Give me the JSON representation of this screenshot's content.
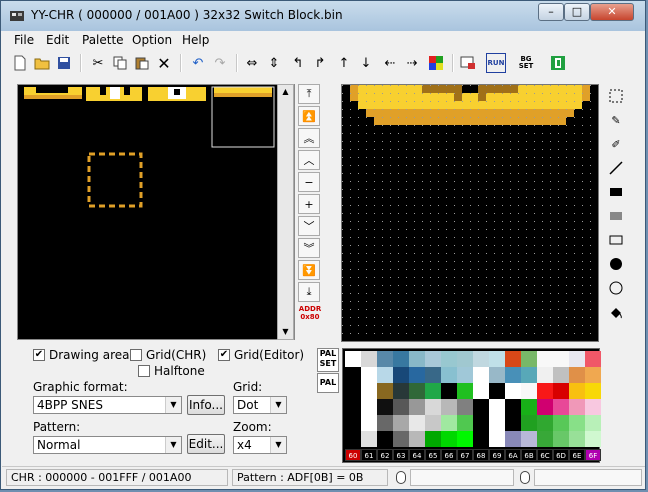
{
  "window": {
    "title": "YY-CHR ( 000000 / 001A00 ) 32x32 Switch Block.bin",
    "app_icon": "chr-icon"
  },
  "menu": [
    "File",
    "Edit",
    "Palette",
    "Option",
    "Help"
  ],
  "toolbar": {
    "buttons": [
      "new-icon",
      "open-icon",
      "save-icon",
      "cut-icon",
      "copy-icon",
      "paste-icon",
      "delete-icon",
      "undo-icon",
      "redo-icon",
      "flip-horizontal-icon",
      "flip-vertical-icon",
      "rotate-left-icon",
      "rotate-right-icon",
      "shift-up-icon",
      "shift-down-icon",
      "shift-left-icon",
      "shift-right-icon",
      "color-replace-icon",
      "pattern-icon",
      "run-icon",
      "bg-set-icon",
      "exit-icon"
    ],
    "run_label": "RUN",
    "bgset_label": "BG SET"
  },
  "nav": {
    "addr_label": "ADDR",
    "addr_value": "0x80"
  },
  "options": {
    "drawing_area": {
      "label": "Drawing area",
      "checked": true
    },
    "grid_chr": {
      "label": "Grid(CHR)",
      "checked": false
    },
    "grid_editor": {
      "label": "Grid(Editor)",
      "checked": true
    },
    "halftone": {
      "label": "Halftone",
      "checked": false
    }
  },
  "graphic_format": {
    "label": "Graphic format:",
    "value": "4BPP SNES",
    "info_button": "Info..."
  },
  "grid": {
    "label": "Grid:",
    "value": "Dot"
  },
  "pattern": {
    "label": "Pattern:",
    "value": "Normal",
    "edit_button": "Edit..."
  },
  "zoom": {
    "label": "Zoom:",
    "value": "x4"
  },
  "palette_panel": {
    "pal_set_label": "PAL SET",
    "pal_tab_label": "PAL",
    "indices": [
      "60",
      "61",
      "62",
      "63",
      "64",
      "65",
      "66",
      "67",
      "68",
      "69",
      "6A",
      "6B",
      "6C",
      "6D",
      "6E",
      "6F"
    ],
    "colors": [
      [
        "#ffffff",
        "#d8d8d8",
        "#5888a8",
        "#3878a0",
        "#88b8c8",
        "#a8c8d8",
        "#98c8d0",
        "#a0c8d0",
        "#c0d8e0",
        "#c0e0e8",
        "#d84818",
        "#78b868",
        "#f8f8f8",
        "#f8f8f8",
        "#e8e8f0",
        "#f05868"
      ],
      [
        "#000000",
        "#ffffff",
        "#b8d8e8",
        "#184878",
        "#2868a0",
        "#386888",
        "#88c0d0",
        "#a0c8d8",
        "#ffffff",
        "#98b8c8",
        "#4890b8",
        "#58a8b8",
        "#f0f0f0",
        "#c0c0c0",
        "#e09048",
        "#f0a850"
      ],
      [
        "#000000",
        "#ffffff",
        "#886820",
        "#283838",
        "#306838",
        "#20a848",
        "#000000",
        "#20c020",
        "#ffffff",
        "#000000",
        "#ffffff",
        "#f8f8f8",
        "#f81818",
        "#d80000",
        "#f8c010",
        "#f8d808"
      ],
      [
        "#000000",
        "#ffffff",
        "#101010",
        "#585858",
        "#989898",
        "#d8d8d8",
        "#b8b8b8",
        "#808080",
        "#000000",
        "#ffffff",
        "#000000",
        "#18b018",
        "#d00070",
        "#e84898",
        "#f098b8",
        "#f8c8e0"
      ],
      [
        "#000000",
        "#ffffff",
        "#686868",
        "#a8a8a8",
        "#e8e8e8",
        "#c8c8c8",
        "#a0e8a0",
        "#50c850",
        "#000000",
        "#ffffff",
        "#000000",
        "#20a020",
        "#30a830",
        "#58c858",
        "#88e088",
        "#b8f0b8"
      ],
      [
        "#000000",
        "#e0e0e0",
        "#000000",
        "#686868",
        "#b8b8b8",
        "#00a800",
        "#00d800",
        "#00f800",
        "#000000",
        "#ffffff",
        "#8888b8",
        "#b8b8d8",
        "#38a838",
        "#68c868",
        "#98e098",
        "#d0f8d0"
      ]
    ]
  },
  "status": {
    "chr_range": "CHR : 000000 - 001FFF / 001A00",
    "pattern_info": "Pattern : ADF[0B] = 0B"
  },
  "colors": {
    "block_yellow": "#f8d030",
    "block_orange": "#e0a028",
    "block_dark": "#a07018",
    "accent_blue": "#2060c8"
  }
}
